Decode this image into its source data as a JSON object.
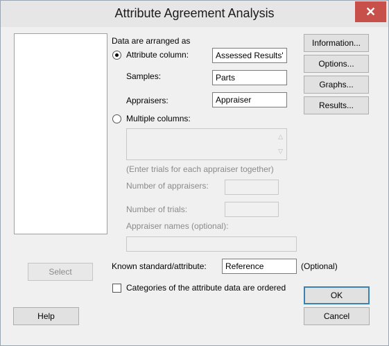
{
  "window": {
    "title": "Attribute Agreement Analysis",
    "close_glyph": "✕"
  },
  "arrangement": {
    "heading": "Data are arranged as",
    "attribute_column_label": "Attribute column:",
    "attribute_column_value": "Assessed Results'",
    "samples_label": "Samples:",
    "samples_value": "Parts",
    "appraisers_label": "Appraisers:",
    "appraisers_value": "Appraiser",
    "multiple_columns_label": "Multiple columns:",
    "multiple_columns_hint": "(Enter trials for each appraiser together)",
    "num_appraisers_label": "Number of appraisers:",
    "num_trials_label": "Number of trials:",
    "appraiser_names_label": "Appraiser names (optional):",
    "selected_option": "attribute_column"
  },
  "known_standard": {
    "label": "Known standard/attribute:",
    "value": "Reference",
    "optional_note": "(Optional)"
  },
  "ordered_checkbox_label": "Categories of the attribute data are ordered",
  "side_buttons": {
    "information": "Information...",
    "options": "Options...",
    "graphs": "Graphs...",
    "results": "Results..."
  },
  "bottom_buttons": {
    "select": "Select",
    "help": "Help",
    "ok": "OK",
    "cancel": "Cancel"
  },
  "icons": {
    "scroll_up": "up-arrow",
    "scroll_down": "down-arrow"
  }
}
